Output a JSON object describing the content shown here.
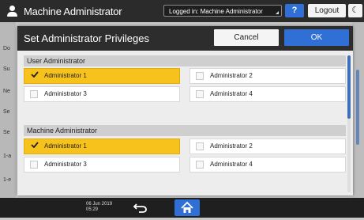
{
  "topbar": {
    "title": "Machine Administrator",
    "login_status": "Logged in: Machine Administrator",
    "help_label": "?",
    "logout_label": "Logout",
    "sleep_icon": "moon-icon"
  },
  "background": {
    "side_labels": [
      "Do",
      "Su",
      "Ne",
      "Se",
      "Se",
      "1-a",
      "1-e"
    ]
  },
  "dialog": {
    "title": "Set Administrator Privileges",
    "cancel_label": "Cancel",
    "ok_label": "OK",
    "sections": [
      {
        "heading": "User Administrator",
        "options": [
          {
            "label": "Administrator 1",
            "checked": true
          },
          {
            "label": "Administrator 2",
            "checked": false
          },
          {
            "label": "Administrator 3",
            "checked": false
          },
          {
            "label": "Administrator 4",
            "checked": false
          }
        ]
      },
      {
        "heading": "Machine Administrator",
        "options": [
          {
            "label": "Administrator 1",
            "checked": true
          },
          {
            "label": "Administrator 2",
            "checked": false
          },
          {
            "label": "Administrator 3",
            "checked": false
          },
          {
            "label": "Administrator 4",
            "checked": false
          }
        ]
      }
    ]
  },
  "bottombar": {
    "date": "06 Jun 2019",
    "time": "05:29",
    "back_icon": "back-arrow-icon",
    "home_icon": "home-icon"
  },
  "colors": {
    "accent": "#2f6fd6",
    "selected": "#f7c21b",
    "header_dark": "#2d2d2d"
  }
}
